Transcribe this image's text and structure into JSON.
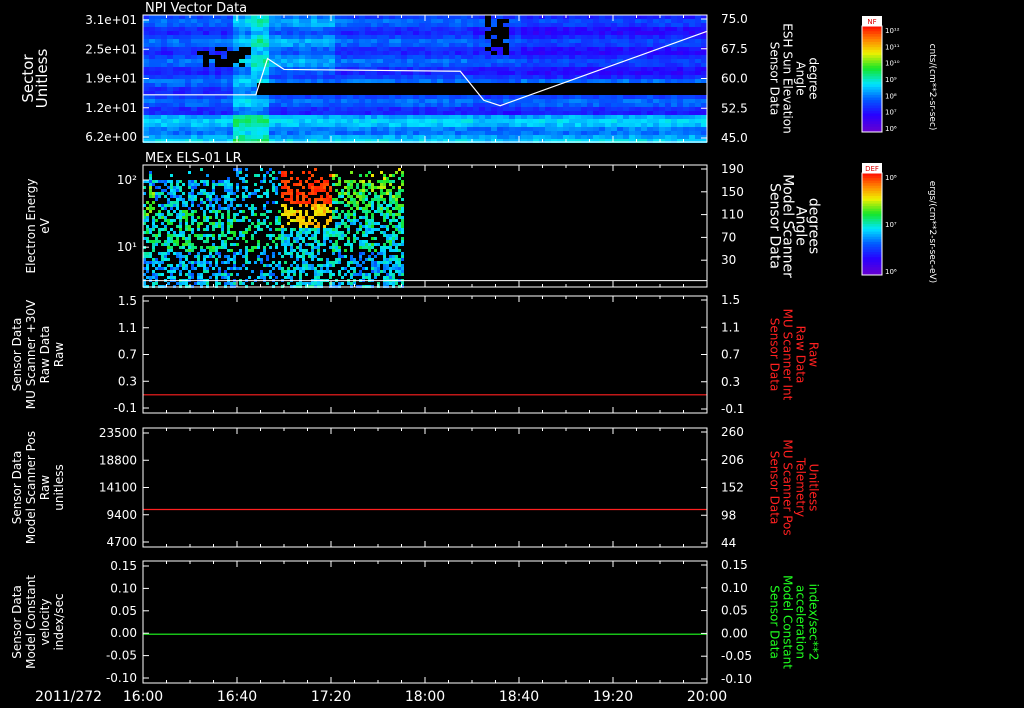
{
  "time_axis": {
    "date": "2011/272",
    "labels": [
      "16:00",
      "16:40",
      "17:20",
      "18:00",
      "18:40",
      "19:20",
      "20:00"
    ]
  },
  "panels": [
    {
      "id": "npi",
      "title": "NPI Vector Data",
      "left_label": [
        "Sector",
        "Unitless"
      ],
      "left_ticks": [
        "3.1e+01",
        "2.5e+01",
        "1.9e+01",
        "1.2e+01",
        "6.2e+00"
      ],
      "right_label": [
        "Sensor Data",
        "ESH Sun Elevation",
        "Angle",
        "degree"
      ],
      "right_ticks": [
        "75.0",
        "67.5",
        "60.0",
        "52.5",
        "45.0"
      ],
      "colorbar": {
        "label": "NF",
        "unit": "cnts/(cm**2-sr-sec)",
        "ticks": [
          "10¹²",
          "10¹¹",
          "10¹⁰",
          "10⁹",
          "10⁸",
          "10⁷",
          "10⁶"
        ]
      }
    },
    {
      "id": "els",
      "title": "MEx ELS-01 LR",
      "left_label": [
        "Electron Energy",
        "eV"
      ],
      "left_ticks": [
        "10²",
        "10¹"
      ],
      "right_label": [
        "Sensor Data",
        "Model Scanner",
        "Angle",
        "degrees"
      ],
      "right_ticks": [
        "190",
        "150",
        "110",
        "70",
        "30"
      ],
      "colorbar": {
        "label": "DEF",
        "unit": "ergs/(cm**2-sr-sec-eV)",
        "ticks": [
          "10⁸",
          "10⁷",
          "10⁶"
        ]
      }
    },
    {
      "id": "mu30",
      "left_label": [
        "Sensor Data",
        "MU Scanner +30V",
        "Raw Data",
        "Raw"
      ],
      "left_ticks": [
        "1.5",
        "1.1",
        "0.7",
        "0.3",
        "-0.1"
      ],
      "right_label": [
        "Sensor Data",
        "MU Scanner Int",
        "Raw Data",
        "Raw"
      ],
      "right_ticks": [
        "1.5",
        "1.1",
        "0.7",
        "0.3",
        "-0.1"
      ],
      "right_color": "#ff2020"
    },
    {
      "id": "pos",
      "left_label": [
        "Sensor Data",
        "Model Scanner Pos",
        "Raw",
        "unitless"
      ],
      "left_ticks": [
        "23500",
        "18800",
        "14100",
        "9400",
        "4700"
      ],
      "right_label": [
        "Sensor Data",
        "MU Scanner Pos",
        "Telemetry",
        "Unitless"
      ],
      "right_ticks": [
        "260",
        "206",
        "152",
        "98",
        "44"
      ],
      "right_color": "#ff2020"
    },
    {
      "id": "vel",
      "left_label": [
        "Sensor Data",
        "Model Constant",
        "velocity",
        "index/sec"
      ],
      "left_ticks": [
        "0.15",
        "0.10",
        "0.05",
        "0.00",
        "-0.05",
        "-0.10"
      ],
      "right_label": [
        "Sensor Data",
        "Model Constant",
        "acceleration",
        "index/sec**2"
      ],
      "right_ticks": [
        "0.15",
        "0.10",
        "0.05",
        "0.00",
        "-0.05",
        "-0.10"
      ],
      "right_color": "#20ff20"
    }
  ],
  "chart_data": [
    {
      "type": "heatmap",
      "title": "NPI Vector Data",
      "x_range": [
        "16:00",
        "20:00"
      ],
      "y_scale": "log",
      "overlay_series": {
        "name": "Sensor Data ESH Sun Elevation Angle",
        "axis": "right",
        "ylim": [
          40.0,
          75.0
        ],
        "x": [
          "16:00",
          "16:48",
          "16:53",
          "17:00",
          "18:15",
          "18:25",
          "18:32",
          "20:00"
        ],
        "y": [
          53.0,
          53.0,
          63.0,
          60.0,
          59.5,
          51.5,
          50.0,
          70.5
        ]
      }
    },
    {
      "type": "heatmap",
      "title": "MEx ELS-01 LR",
      "x_range": [
        "16:00",
        "20:00"
      ],
      "y_scale": "log",
      "data_coverage": [
        "16:00",
        "17:50"
      ],
      "overlay_series": {
        "name": "Sensor Data Model Scanner Angle",
        "axis": "right",
        "ylim": [
          0,
          190
        ],
        "x": [
          "16:00",
          "20:00"
        ],
        "y": [
          10,
          10
        ]
      }
    },
    {
      "type": "line",
      "x_range": [
        "16:00",
        "20:00"
      ],
      "ylim": [
        -0.3,
        1.5
      ],
      "series": [
        {
          "name": "Sensor Data MU Scanner Int Raw Data",
          "color": "#ff2020",
          "x": [
            "16:00",
            "20:00"
          ],
          "y": [
            -0.02,
            -0.02
          ]
        }
      ]
    },
    {
      "type": "line",
      "x_range": [
        "16:00",
        "20:00"
      ],
      "ylim": [
        0,
        23500
      ],
      "series": [
        {
          "name": "Sensor Data MU Scanner Pos Telemetry",
          "color": "#ff2020",
          "x": [
            "16:00",
            "20:00"
          ],
          "y": [
            7400,
            7400
          ]
        }
      ]
    },
    {
      "type": "line",
      "x_range": [
        "16:00",
        "20:00"
      ],
      "ylim": [
        -0.1,
        0.15
      ],
      "series": [
        {
          "name": "Sensor Data Model Constant acceleration",
          "color": "#20ff20",
          "x": [
            "16:00",
            "20:00"
          ],
          "y": [
            0.0,
            0.0
          ]
        }
      ]
    }
  ]
}
